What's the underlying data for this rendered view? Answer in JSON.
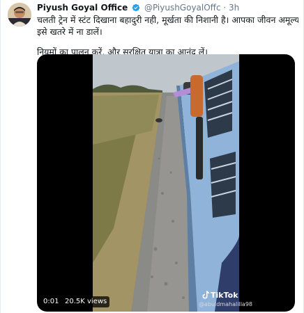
{
  "tweet": {
    "display_name": "Piyush Goyal Office",
    "handle": "@PiyushGoyalOffc",
    "separator": "·",
    "time": "3h",
    "lines": [
      "चलती ट्रेन में स्टंट दिखाना बहादुरी नही, मूर्खता की निशानी है। आपका जीवन अमूल्य है,",
      "इसे खतरे में ना डालें।",
      "नियमों का पालन करें,  और सुरक्षित यात्रा का आनंद लें।"
    ]
  },
  "media": {
    "elapsed": "0:01",
    "views": "20.5K views",
    "watermark_brand": "TikTok",
    "watermark_user": "@abuldmahalilla98"
  },
  "colors": {
    "verified": "#1da1f2",
    "secondary_text": "#657786",
    "train_blue": "#8fb3d9"
  }
}
